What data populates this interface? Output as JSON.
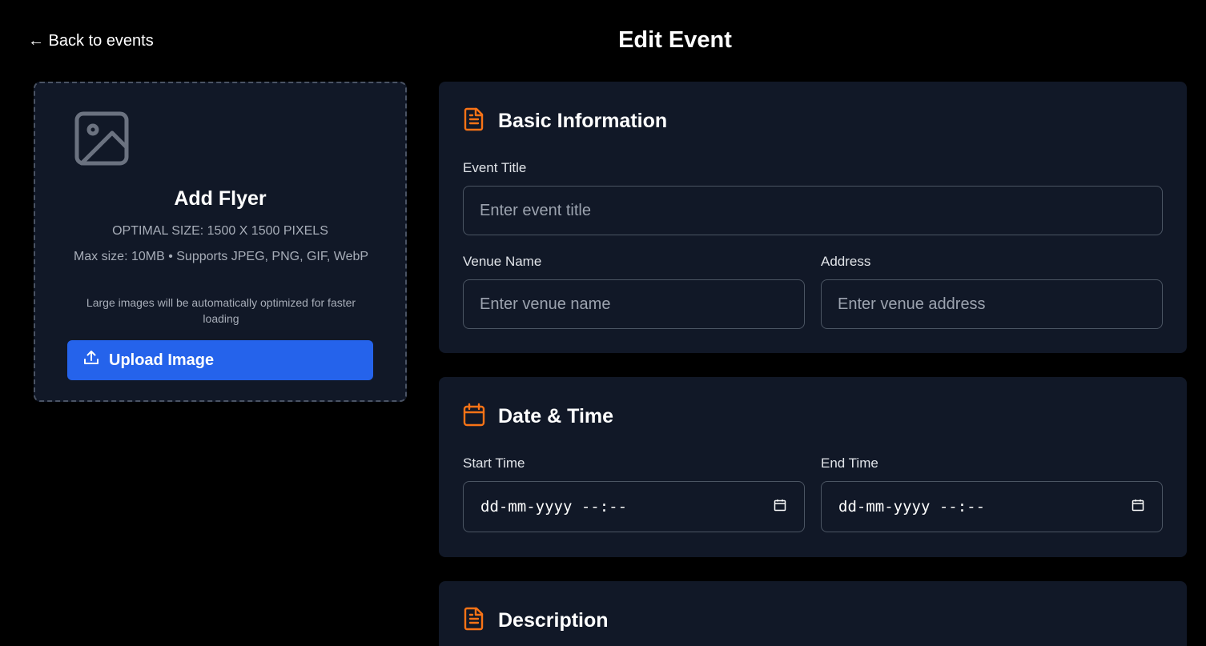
{
  "nav": {
    "back_label": "← Back to events"
  },
  "page": {
    "title": "Edit Event"
  },
  "flyer": {
    "title": "Add Flyer",
    "optimal_size": "OPTIMAL SIZE: 1500 X 1500 PIXELS",
    "max_size": "Max size: 10MB • Supports JPEG, PNG, GIF, WebP",
    "optimize_note": "Large images will be automatically optimized for faster loading",
    "upload_label": "Upload Image",
    "icons": {
      "placeholder": "image-icon",
      "upload": "upload-icon"
    }
  },
  "basic_info": {
    "title": "Basic Information",
    "icon": "document-icon",
    "event_title_label": "Event Title",
    "event_title_placeholder": "Enter event title",
    "venue_label": "Venue Name",
    "venue_placeholder": "Enter venue name",
    "address_label": "Address",
    "address_placeholder": "Enter venue address"
  },
  "date_time": {
    "title": "Date & Time",
    "icon": "calendar-icon",
    "start_label": "Start Time",
    "start_value": "dd-mm-yyyy --:--",
    "end_label": "End Time",
    "end_value": "dd-mm-yyyy --:--"
  },
  "description": {
    "title": "Description",
    "icon": "document-icon"
  },
  "colors": {
    "background": "#000000",
    "card": "#111827",
    "accent": "#f97316",
    "primary_button": "#2563eb",
    "input_border": "#4b5563"
  }
}
